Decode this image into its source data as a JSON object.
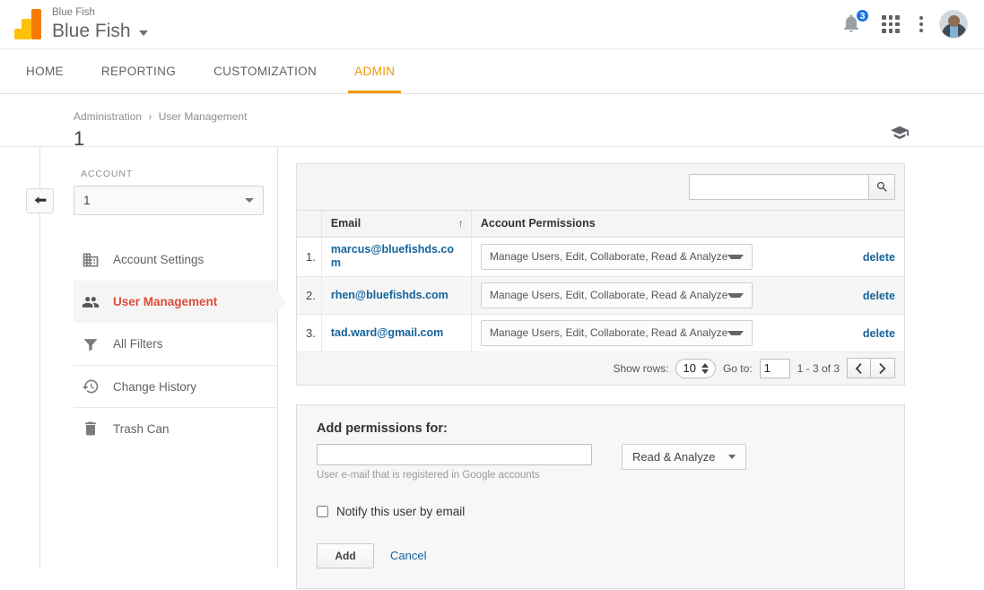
{
  "header": {
    "brand_small": "Blue Fish",
    "brand_main": "Blue Fish",
    "logo_icon": "google-analytics-logo",
    "notifications_count": "3",
    "bell_icon": "bell-icon",
    "apps_icon": "apps-grid-icon",
    "more_icon": "kebab-menu-icon",
    "avatar_icon": "user-avatar"
  },
  "nav": {
    "tabs": [
      {
        "label": "HOME",
        "active": false
      },
      {
        "label": "REPORTING",
        "active": false
      },
      {
        "label": "CUSTOMIZATION",
        "active": false
      },
      {
        "label": "ADMIN",
        "active": true
      }
    ],
    "accent_color": "#f29900"
  },
  "pagehead": {
    "crumb_1": "Administration",
    "crumb_sep": "›",
    "crumb_2": "User Management",
    "title": "1",
    "academy_icon": "graduation-cap-icon"
  },
  "sidebar": {
    "back_icon": "back-arrow-icon",
    "account_label": "ACCOUNT",
    "account_value": "1",
    "items": [
      {
        "label": "Account Settings",
        "icon": "building-icon",
        "active": false
      },
      {
        "label": "User Management",
        "icon": "people-group-icon",
        "active": true
      },
      {
        "label": "All Filters",
        "icon": "funnel-filter-icon",
        "active": false
      },
      {
        "label": "Change History",
        "icon": "history-clock-icon",
        "active": false
      },
      {
        "label": "Trash Can",
        "icon": "trash-can-icon",
        "active": false
      }
    ],
    "active_color": "#dd4b39"
  },
  "users_panel": {
    "search": {
      "value": "",
      "placeholder": "",
      "icon": "search-icon"
    },
    "columns": {
      "number": "",
      "email": "Email",
      "permissions": "Account Permissions",
      "actions": ""
    },
    "sort_indicator": "↑",
    "rows": [
      {
        "num": "1.",
        "email": "marcus@bluefishds.com",
        "permission": "Manage Users, Edit, Collaborate, Read & Analyze",
        "delete_label": "delete"
      },
      {
        "num": "2.",
        "email": "rhen@bluefishds.com",
        "permission": "Manage Users, Edit, Collaborate, Read & Analyze",
        "delete_label": "delete"
      },
      {
        "num": "3.",
        "email": "tad.ward@gmail.com",
        "permission": "Manage Users, Edit, Collaborate, Read & Analyze",
        "delete_label": "delete"
      }
    ],
    "pager": {
      "show_rows_label": "Show rows:",
      "show_rows_value": "10",
      "goto_label": "Go to:",
      "goto_value": "1",
      "range_text": "1 - 3 of 3",
      "prev_icon": "chevron-left-icon",
      "next_icon": "chevron-right-icon"
    }
  },
  "add_panel": {
    "title": "Add permissions for:",
    "email_value": "",
    "email_placeholder": "",
    "hint": "User e-mail that is registered in Google accounts",
    "role_value": "Read & Analyze",
    "notify_label": "Notify this user by email",
    "notify_checked": false,
    "add_label": "Add",
    "cancel_label": "Cancel"
  }
}
